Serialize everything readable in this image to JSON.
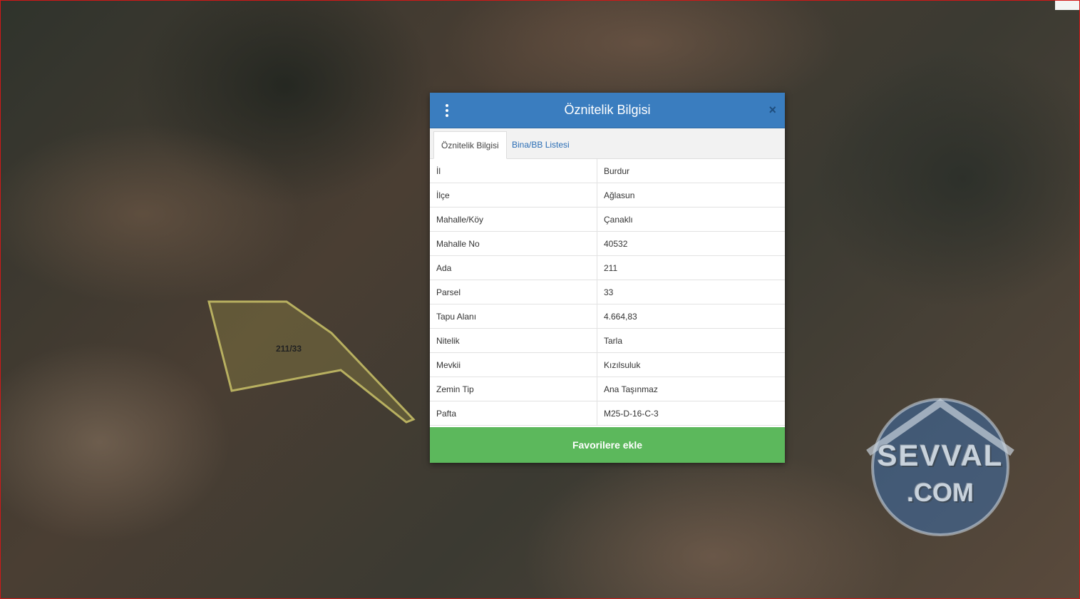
{
  "map": {
    "parcel_label": "211/33",
    "parcel_color": "#b8b060"
  },
  "dialog": {
    "title": "Öznitelik Bilgisi",
    "menu_icon": "vertical-dots-icon",
    "close_icon": "close-icon",
    "close_symbol": "×",
    "tabs": [
      {
        "label": "Öznitelik Bilgisi",
        "active": true
      },
      {
        "label": "Bina/BB Listesi",
        "active": false
      }
    ],
    "rows": [
      {
        "key": "İl",
        "value": "Burdur"
      },
      {
        "key": "İlçe",
        "value": "Ağlasun"
      },
      {
        "key": "Mahalle/Köy",
        "value": "Çanaklı"
      },
      {
        "key": "Mahalle No",
        "value": "40532"
      },
      {
        "key": "Ada",
        "value": "211"
      },
      {
        "key": "Parsel",
        "value": "33"
      },
      {
        "key": "Tapu Alanı",
        "value": "4.664,83"
      },
      {
        "key": "Nitelik",
        "value": "Tarla"
      },
      {
        "key": "Mevkii",
        "value": "Kızılsuluk"
      },
      {
        "key": "Zemin Tip",
        "value": "Ana Taşınmaz"
      },
      {
        "key": "Pafta",
        "value": "M25-D-16-C-3"
      }
    ],
    "favorite_button": "Favorilere ekle",
    "header_color": "#3a7dbf",
    "button_color": "#5cb85c"
  },
  "watermark": {
    "line1": "SEVVAL",
    "line2": ".COM"
  }
}
